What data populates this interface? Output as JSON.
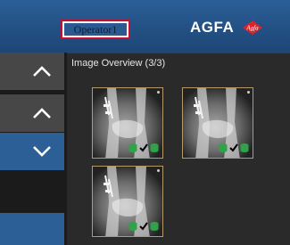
{
  "header": {
    "operator_label": "Operator1",
    "brand": "AGFA",
    "brand_logo_text": "Agfa"
  },
  "left_nav": {
    "buttons": [
      {
        "icon": "chevron-up-icon",
        "active": false
      },
      {
        "icon": "chevron-up-icon",
        "active": false
      },
      {
        "icon": "chevron-down-icon",
        "active": true
      }
    ]
  },
  "overview": {
    "title": "Image Overview (3/3)",
    "thumbnails": [
      {
        "name": "image-1",
        "status": [
          "done",
          "sent",
          "stored"
        ]
      },
      {
        "name": "image-2",
        "status": [
          "done",
          "sent",
          "stored"
        ]
      },
      {
        "name": "image-3",
        "status": [
          "done",
          "sent",
          "stored"
        ]
      }
    ]
  },
  "colors": {
    "header_blue": "#2a5f97",
    "active_blue": "#2b5f96",
    "button_gray": "#474747",
    "panel_bg": "#2a2a2a",
    "thumb_border": "#b59a6b",
    "status_green": "#2fa24a",
    "accent_red": "#c8102e"
  }
}
